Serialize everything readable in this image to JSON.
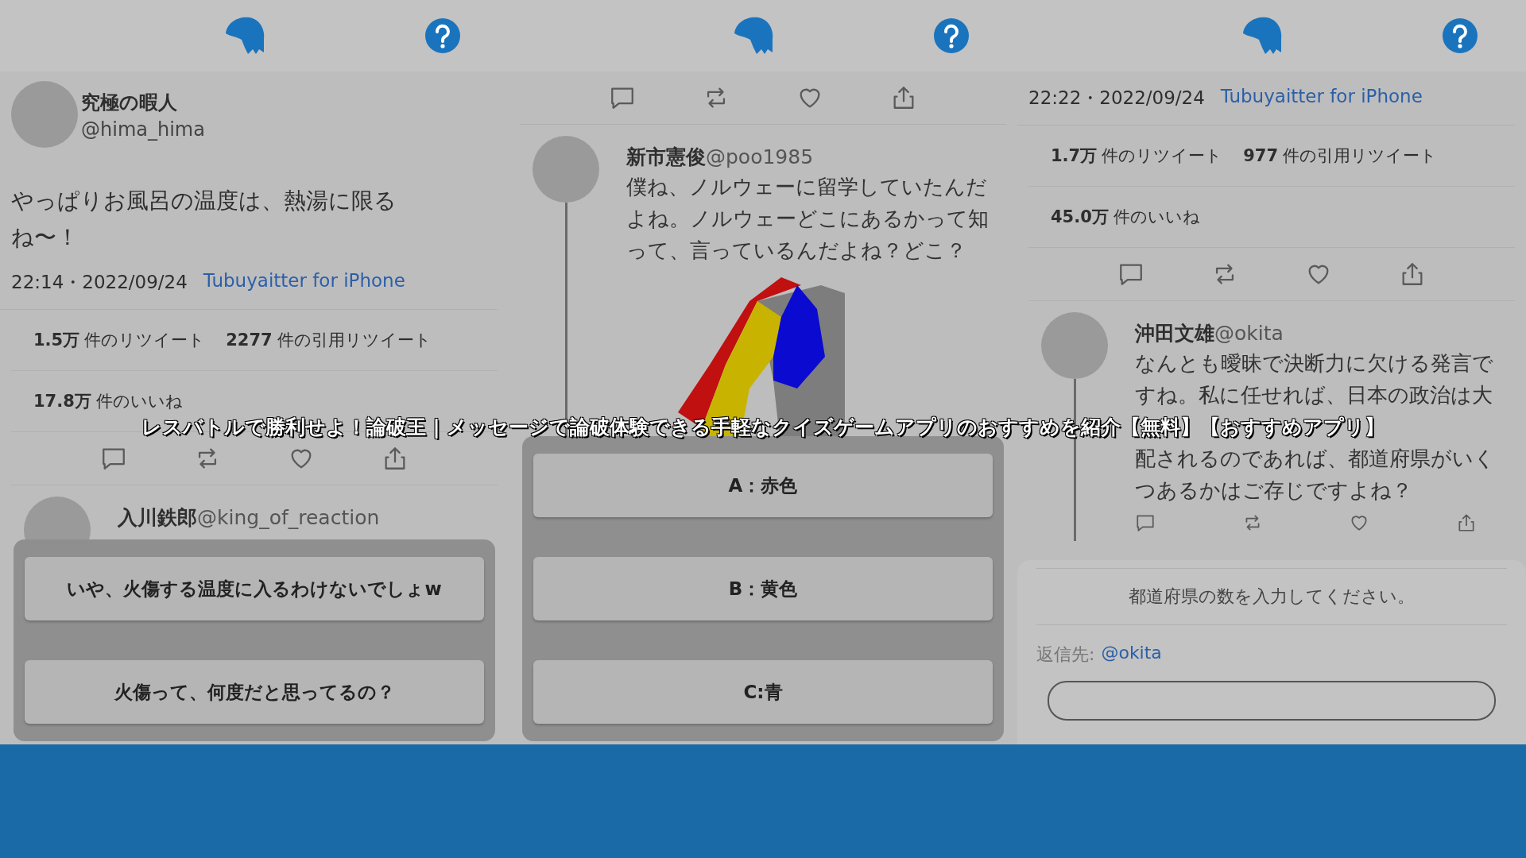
{
  "title": "レスバトルで勝利せよ！論破王 | メッセージで論破体験できる手軽なクイズゲームアプリのおすすめを紹介【無料】【おすすめアプリ】",
  "panels": [
    {
      "blocks": [
        {
          "kind": "author",
          "name": "究極の暇人",
          "handle": "@hima_hima"
        },
        {
          "kind": "body",
          "text": "やっぱりお風呂の温度は、熱湯に限るね〜！"
        },
        {
          "kind": "meta",
          "time": "22:14・2022/09/24",
          "source": "Tubuyaitter for iPhone"
        },
        {
          "kind": "stats",
          "retweets": "1.5万",
          "retweets_label": "件のリツイート",
          "quotes": "2277",
          "quotes_label": "件の引用リツイート"
        },
        {
          "kind": "likes",
          "count": "17.8万",
          "label": "件のいいね"
        },
        {
          "kind": "actions"
        },
        {
          "kind": "reply",
          "name": "入川鉄郎",
          "handle": "@king_of_reaction"
        }
      ],
      "sheet": {
        "kind": "answers",
        "options": [
          "いや、火傷する温度に入るわけないでしょw",
          "火傷って、何度だと思ってるの？"
        ]
      }
    },
    {
      "blocks": [
        {
          "kind": "actions"
        },
        {
          "kind": "reply",
          "name": "新市憲俊",
          "handle": "@poo1985",
          "texts": [
            "僕ね、ノルウェーに留学していたんだよね。ノルウェーどこにあるかって知って、言っているんだよね？どこ？"
          ],
          "map": true
        }
      ],
      "sheet": {
        "kind": "answers",
        "options": [
          "A：赤色",
          "B：黄色",
          "C:青"
        ]
      }
    },
    {
      "blocks": [
        {
          "kind": "meta",
          "time": "22:22・2022/09/24",
          "source": "Tubuyaitter for iPhone"
        },
        {
          "kind": "stats",
          "retweets": "1.7万",
          "retweets_label": "件のリツイート",
          "quotes": "977",
          "quotes_label": "件の引用リツイート"
        },
        {
          "kind": "likes",
          "count": "45.0万",
          "label": "件のいいね"
        },
        {
          "kind": "actions"
        },
        {
          "kind": "reply",
          "name": "沖田文雄",
          "handle": "@okita",
          "texts": [
            "なんとも曖昧で決断力に欠ける発言ですね。私に任せれば、日本の政治は大",
            "配されるのであれば、都道府県がいくつあるかはご存じですよね？"
          ],
          "mini_actions": true
        }
      ],
      "sheet": {
        "kind": "input",
        "prompt": "都道府県の数を入力してください。",
        "reply_label": "返信先:",
        "reply_handle": "@okita"
      }
    }
  ]
}
